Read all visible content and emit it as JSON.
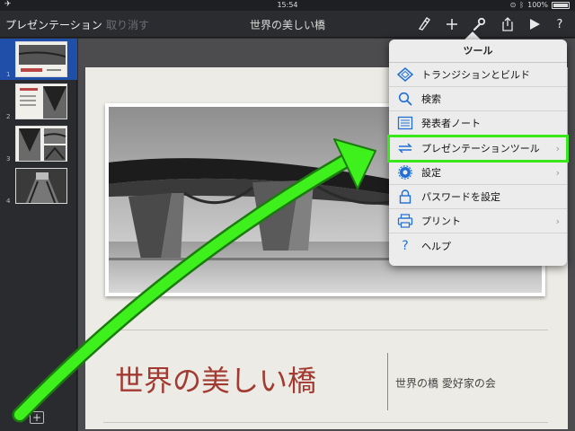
{
  "status_bar": {
    "time": "15:54",
    "battery": "100%"
  },
  "toolbar": {
    "back_label": "プレゼンテーション",
    "undo_label": "取り消す",
    "title": "世界の美しい橋",
    "icons": [
      "format-brush-icon",
      "plus-icon",
      "wrench-icon",
      "share-icon",
      "play-icon",
      "help-icon"
    ]
  },
  "sidebar": {
    "slides": [
      {
        "number": "1",
        "selected": true
      },
      {
        "number": "2",
        "selected": false
      },
      {
        "number": "3",
        "selected": false
      },
      {
        "number": "4",
        "selected": false
      }
    ],
    "add_slide_label": "+"
  },
  "slide": {
    "title": "世界の美しい橋",
    "subtitle": "世界の橋 愛好家の会",
    "title_color": "#a23a32"
  },
  "tools_popover": {
    "title": "ツール",
    "items": [
      {
        "label": "トランジションとビルド",
        "icon": "transition-icon",
        "chevron": ""
      },
      {
        "label": "検索",
        "icon": "search-icon",
        "chevron": ""
      },
      {
        "label": "発表者ノート",
        "icon": "notes-icon",
        "chevron": ""
      },
      {
        "label": "プレゼンテーションツール",
        "icon": "presentation-tools-icon",
        "chevron": "›",
        "highlighted": true
      },
      {
        "label": "設定",
        "icon": "settings-icon",
        "chevron": "›"
      },
      {
        "label": "パスワードを設定",
        "icon": "lock-icon",
        "chevron": ""
      },
      {
        "label": "プリント",
        "icon": "printer-icon",
        "chevron": "›"
      },
      {
        "label": "ヘルプ",
        "icon": "help-icon",
        "chevron": ""
      }
    ]
  },
  "colors": {
    "highlight": "#39e819",
    "accent_blue": "#1f6fd6"
  }
}
